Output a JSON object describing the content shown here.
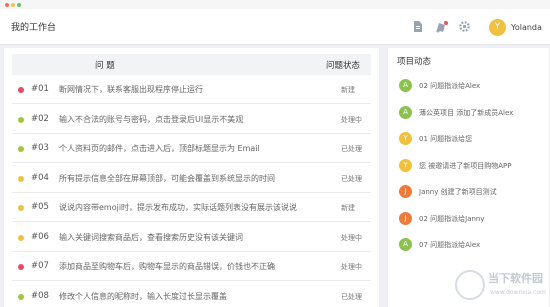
{
  "window": {
    "controls": [
      "#f26b5f",
      "#f7bd4f",
      "#5dc85c"
    ]
  },
  "header": {
    "title": "我的工作台",
    "user": {
      "avatar_letter": "Y",
      "name": "Yolanda",
      "avatar_color": "#f0c040"
    },
    "icons": [
      "document-icon",
      "notification-icon",
      "gear-icon"
    ]
  },
  "issues": {
    "columns": {
      "issue": "问 题",
      "status": "问题状态"
    },
    "rows": [
      {
        "id": "#01",
        "text": "断网情况下，联系客服出现程序停止运行",
        "status": "新建",
        "color": "#e8496a"
      },
      {
        "id": "#02",
        "text": "输入不合法的账号与密码，点击登录后UI显示不美观",
        "status": "处理中",
        "color": "#a5c63b"
      },
      {
        "id": "#03",
        "text": "个人资料页的邮件，点击进入后，顶部标题显示为 Email",
        "status": "已处理",
        "color": "#a5c63b"
      },
      {
        "id": "#04",
        "text": "所有提示信息全部在屏幕顶部，可能会覆盖到系统显示的时间",
        "status": "已处理",
        "color": "#f0c040"
      },
      {
        "id": "#05",
        "text": "说说内容带emoji时，提示发布成功，实际话题列表没有展示该说说",
        "status": "新建",
        "color": "#f0c040"
      },
      {
        "id": "#06",
        "text": "输入关键词搜索商品后，查看搜索历史没有该关键词",
        "status": "处理中",
        "color": "#f0c040"
      },
      {
        "id": "#07",
        "text": "添加商品至购物车后，购物车显示的商品错误，价钱也不正确",
        "status": "处理中",
        "color": "#e8496a"
      },
      {
        "id": "#08",
        "text": "修改个人信息的昵称时，输入长度过长显示覆盖",
        "status": "已处理",
        "color": "#a5c63b"
      }
    ]
  },
  "activity": {
    "title": "项目动态",
    "items": [
      {
        "letter": "A",
        "color": "#8cc152",
        "text": "02 问题指派给Alex"
      },
      {
        "letter": "A",
        "color": "#8cc152",
        "text": "薄公英项目 添加了新成员Alex"
      },
      {
        "letter": "Y",
        "color": "#f0c040",
        "text": "01 问题指派给您"
      },
      {
        "letter": "Y",
        "color": "#f0c040",
        "text": "您 被邀请进了新项目购物APP"
      },
      {
        "letter": "J",
        "color": "#ee7b3c",
        "text": "Janny 创建了新项目测试"
      },
      {
        "letter": "J",
        "color": "#ee7b3c",
        "text": "02 问题指派给Janny"
      },
      {
        "letter": "A",
        "color": "#8cc152",
        "text": "07 问题指派给Alex"
      }
    ]
  },
  "watermark": {
    "line1": "当下软件园",
    "line2": "www.downxia.com"
  }
}
